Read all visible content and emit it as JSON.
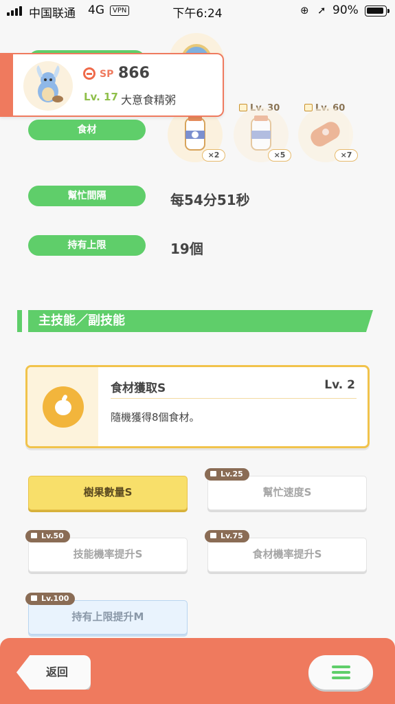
{
  "status_bar": {
    "carrier": "中国联通",
    "network": "4G",
    "vpn": "VPN",
    "time": "下午6:24",
    "battery": "90%"
  },
  "profile": {
    "sp_label": "SP",
    "sp_value": "866",
    "level": "Lv. 17",
    "name": "大意食精粥"
  },
  "abilities": {
    "ingredients_label": "食材",
    "ingredients": [
      {
        "lock_level": "",
        "count": "×2"
      },
      {
        "lock_level": "Lv. 30",
        "count": "×5"
      },
      {
        "lock_level": "Lv. 60",
        "count": "×7"
      }
    ],
    "help_interval_label": "幫忙間隔",
    "help_interval_value": "每54分51秒",
    "carry_limit_label": "持有上限",
    "carry_limit_value": "19個"
  },
  "skills_section": {
    "title": "主技能／副技能",
    "main_skill": {
      "name": "食材獲取S",
      "level": "Lv. 2",
      "description": "隨機獲得8個食材。"
    },
    "sub_skills": [
      {
        "label": "樹果數量S",
        "lock_level": ""
      },
      {
        "label": "幫忙速度S",
        "lock_level": "Lv.25"
      },
      {
        "label": "技能機率提升S",
        "lock_level": "Lv.50"
      },
      {
        "label": "食材機率提升S",
        "lock_level": "Lv.75"
      },
      {
        "label": "持有上限提升M",
        "lock_level": "Lv.100"
      }
    ]
  },
  "bottom_bar": {
    "back_label": "返回",
    "menu_icon": "hamburger-menu-icon"
  },
  "colors": {
    "accent_green": "#5fce6a",
    "accent_coral": "#ef7a5e",
    "gold": "#f1c34b"
  }
}
